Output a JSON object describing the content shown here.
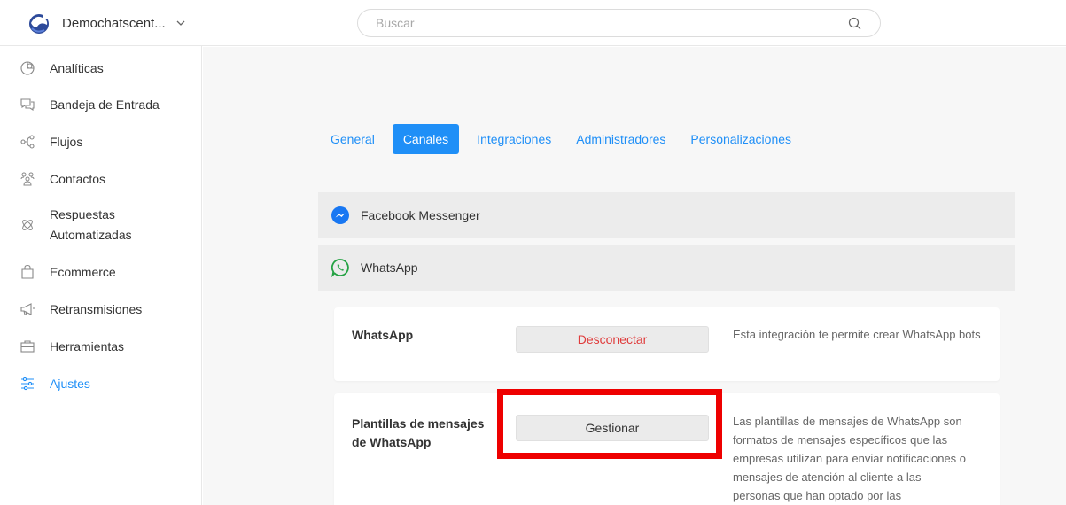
{
  "header": {
    "workspace_name": "Demochatscent...",
    "search_placeholder": "Buscar"
  },
  "sidebar": {
    "items": [
      {
        "label": "Analíticas",
        "icon": "chart-pie-icon"
      },
      {
        "label": "Bandeja de Entrada",
        "icon": "chat-bubbles-icon"
      },
      {
        "label": "Flujos",
        "icon": "flow-icon"
      },
      {
        "label": "Contactos",
        "icon": "contacts-icon"
      },
      {
        "label_line1": "Respuestas",
        "label_line2": "Automatizadas",
        "icon": "atom-icon"
      },
      {
        "label": "Ecommerce",
        "icon": "shopping-bag-icon"
      },
      {
        "label": "Retransmisiones",
        "icon": "megaphone-icon"
      },
      {
        "label": "Herramientas",
        "icon": "toolbox-icon"
      },
      {
        "label": "Ajustes",
        "icon": "sliders-icon",
        "active": true
      }
    ]
  },
  "tabs": [
    {
      "label": "General"
    },
    {
      "label": "Canales",
      "active": true
    },
    {
      "label": "Integraciones"
    },
    {
      "label": "Administradores"
    },
    {
      "label": "Personalizaciones"
    }
  ],
  "channels": [
    {
      "label": "Facebook Messenger",
      "icon": "messenger-icon"
    },
    {
      "label": "WhatsApp",
      "icon": "whatsapp-icon"
    }
  ],
  "cards": [
    {
      "title": "WhatsApp",
      "button": "Desconectar",
      "description": "Esta integración te permite crear WhatsApp bots"
    },
    {
      "title_line1": "Plantillas de mensajes",
      "title_line2": "de WhatsApp",
      "button": "Gestionar",
      "description_lines": [
        "Las plantillas de mensajes de WhatsApp son",
        "formatos de mensajes específicos que las",
        "empresas utilizan para enviar notificaciones o",
        "mensajes de atención al cliente a las",
        "personas que han optado por las"
      ]
    }
  ],
  "colors": {
    "accent": "#1f8ff7",
    "danger": "#e03c3c",
    "highlight": "#ee0000"
  }
}
